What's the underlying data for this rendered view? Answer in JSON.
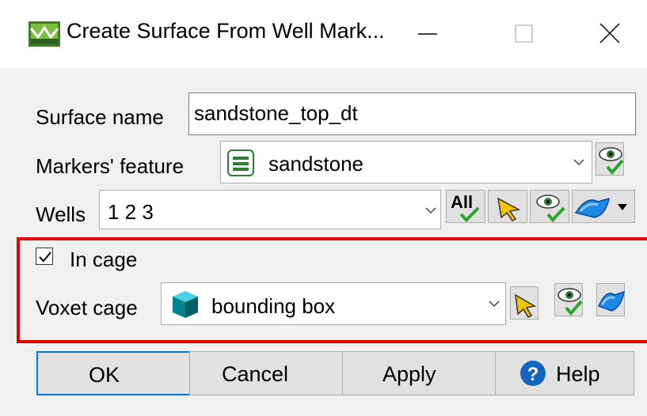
{
  "window": {
    "title": "Create Surface From Well Mark...",
    "icon": "surface-app-icon",
    "controls": [
      "minimize-icon",
      "maximize-icon",
      "close-icon"
    ]
  },
  "form": {
    "surface_name_label": "Surface name",
    "surface_name_value": "sandstone_top_dt",
    "markers_feature_label": "Markers' feature",
    "markers_feature_value": "sandstone",
    "wells_label": "Wells",
    "wells_value": "1 2 3",
    "wells_all_label": "All",
    "in_cage_label": "In cage",
    "in_cage_checked": true,
    "voxet_cage_label": "Voxet cage",
    "voxet_cage_value": "bounding box"
  },
  "buttons": {
    "ok": "OK",
    "cancel": "Cancel",
    "apply": "Apply",
    "help": "Help"
  },
  "colors": {
    "highlight": "#e00000",
    "accent": "#0078d7",
    "check_green": "#2aa52a"
  }
}
